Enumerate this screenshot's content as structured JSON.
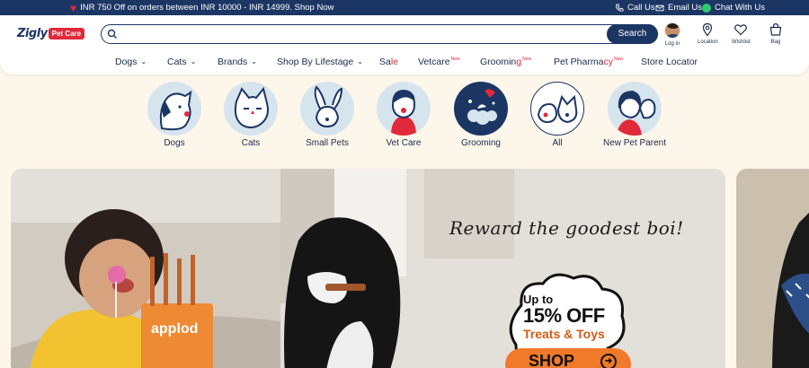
{
  "topbar": {
    "promo": "INR 750 Off on orders between INR 10000 - INR 14999. Shop Now",
    "call": "Call Us",
    "email": "Email Us",
    "chat": "Chat With Us"
  },
  "logo": {
    "name": "Zigly",
    "tag": "Pet Care"
  },
  "search": {
    "placeholder": "",
    "button": "Search"
  },
  "header_icons": {
    "login": "Log in",
    "location": "Location",
    "wishlist": "Wishlist",
    "bag": "Bag"
  },
  "nav": [
    {
      "label": "Dogs"
    },
    {
      "label": "Cats"
    },
    {
      "label": "Brands"
    },
    {
      "label": "Shop By Lifestage"
    },
    {
      "label_a": "Sa",
      "label_b": "le"
    },
    {
      "label": "Vetcare",
      "badge": "New"
    },
    {
      "label_a": "Groomin",
      "label_b": "g",
      "badge": "New"
    },
    {
      "label_a": "Pet Pharma",
      "label_b": "cy",
      "badge": "New"
    },
    {
      "label": "Store Locator"
    }
  ],
  "categories": [
    {
      "label": "Dogs"
    },
    {
      "label": "Cats"
    },
    {
      "label": "Small Pets"
    },
    {
      "label": "Vet Care"
    },
    {
      "label": "Grooming"
    },
    {
      "label": "All"
    },
    {
      "label": "New Pet Parent"
    }
  ],
  "banner": {
    "headline": "Reward the goodest boi!",
    "offer_line1": "Up to",
    "offer_line2": "15% OFF",
    "offer_line3": "Treats & Toys",
    "cta": "SHOP",
    "pack_brand": "applod"
  },
  "colors": {
    "navy": "#1c3664",
    "red": "#e0293a",
    "orange": "#f07a2a",
    "cream": "#fdf6ea"
  }
}
